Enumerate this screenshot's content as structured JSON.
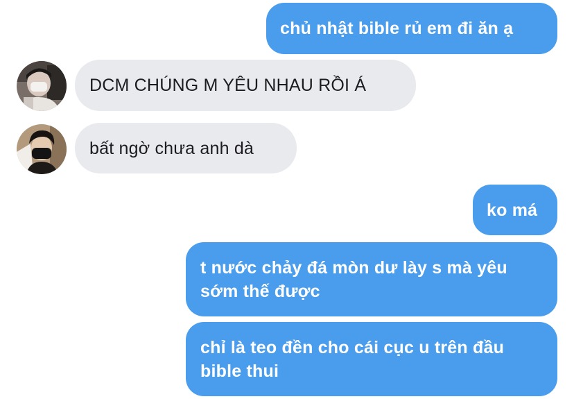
{
  "conversation": {
    "messages": [
      {
        "sender": "me",
        "text": "chủ nhật bible rủ em đi ăn ạ"
      },
      {
        "sender": "contact_1",
        "text": "DCM CHÚNG M YÊU NHAU RỒI Á"
      },
      {
        "sender": "contact_2",
        "text": "bất ngờ chưa anh dà"
      },
      {
        "sender": "me",
        "text": "ko má"
      },
      {
        "sender": "me",
        "lines": [
          "t nước chảy đá mòn dư lày s mà yêu",
          "sớm thế được"
        ]
      },
      {
        "sender": "me",
        "lines": [
          "chỉ là teo đền cho cái cục u trên đầu",
          "bible thui"
        ]
      }
    ]
  },
  "colors": {
    "outgoing_bubble": "#4a9cec",
    "incoming_bubble": "#e9eaee",
    "outgoing_text": "#ffffff",
    "incoming_text": "#1c1c1e"
  },
  "icons": {
    "avatar_1": "profile-photo",
    "avatar_2": "profile-photo"
  }
}
